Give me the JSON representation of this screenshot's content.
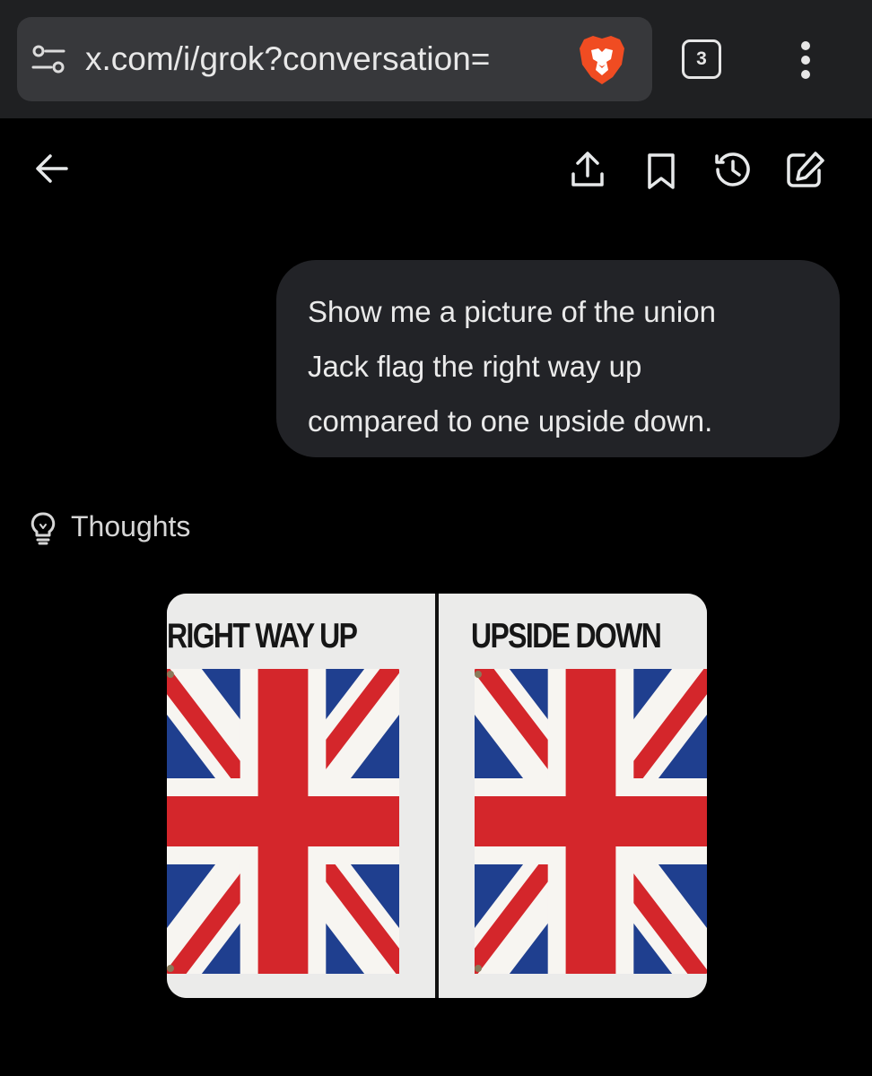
{
  "browser": {
    "url": "x.com/i/grok?conversation=",
    "tab_count": "3"
  },
  "conversation": {
    "user_message": {
      "lines": [
        "Show me a picture of the union",
        "Jack flag the right way up",
        "compared to one upside down."
      ]
    },
    "thoughts_label": "Thoughts",
    "generated_image": {
      "left_title": "RIGHT WAY UP",
      "right_title": "UPSIDE DOWN"
    }
  },
  "icons": {
    "site_settings": "tune-icon",
    "brave": "brave-lion-icon",
    "menu": "vertical-dots-icon",
    "back": "arrow-left-icon",
    "share": "share-icon",
    "bookmark": "bookmark-icon",
    "history": "history-icon",
    "new_chat": "edit-icon",
    "thoughts": "lightbulb-icon"
  },
  "colors": {
    "flag_blue": "#1f3f8f",
    "flag_red": "#d4262b",
    "flag_white": "#f7f5f1",
    "brave_orange": "#f04c22"
  }
}
